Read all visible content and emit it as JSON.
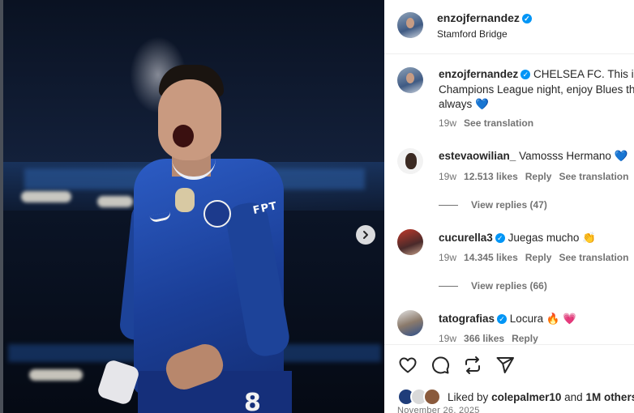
{
  "header": {
    "username": "enzojfernandez",
    "location": "Stamford Bridge"
  },
  "photo": {
    "sponsor": "FPT",
    "shirt_number": "8"
  },
  "caption": {
    "username": "enzojfernandez",
    "line1": "CHELSEA FC. This is r",
    "line2": "Champions League night, enjoy Blues th",
    "line3": "always",
    "emoji": "💙",
    "age": "19w",
    "see_translation": "See translation"
  },
  "comments": [
    {
      "username": "estevaowilian_",
      "text": "Vamosss Hermano",
      "emoji": "💙",
      "age": "19w",
      "likes": "12.513 likes",
      "reply": "Reply",
      "see_translation": "See translation",
      "view_replies": "View replies (47)"
    },
    {
      "username": "cucurella3",
      "text": "Juegas mucho",
      "emoji": "👏",
      "age": "19w",
      "likes": "14.345 likes",
      "reply": "Reply",
      "see_translation": "See translation",
      "view_replies": "View replies (66)"
    },
    {
      "username": "tatografias",
      "text": "Locura",
      "emoji": "🔥 💗",
      "age": "19w",
      "likes": "366 likes",
      "reply": "Reply"
    }
  ],
  "actions": {
    "icons": [
      "heart-icon",
      "comment-icon",
      "repost-icon",
      "share-icon"
    ]
  },
  "likes": {
    "prefix": "Liked by",
    "user": "colepalmer10",
    "middle": "and",
    "others": "1M others"
  },
  "date": "November 26, 2025",
  "colors": {
    "verified": "#0095f6",
    "text": "#262626",
    "muted": "#737373",
    "kit_blue": "#1b3f98"
  }
}
